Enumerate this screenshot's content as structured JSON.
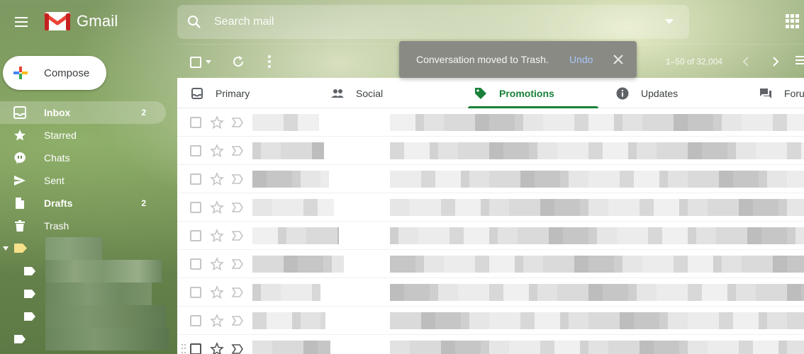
{
  "app": {
    "name": "Gmail",
    "brand_red": "#ea4335",
    "accent_green": "#188038"
  },
  "search": {
    "placeholder": "Search mail"
  },
  "compose": {
    "label": "Compose"
  },
  "sidebar": {
    "items": [
      {
        "label": "Inbox",
        "count": "2",
        "icon": "inbox-icon",
        "active": true,
        "bold": true
      },
      {
        "label": "Starred",
        "count": "",
        "icon": "star-icon",
        "active": false,
        "bold": false
      },
      {
        "label": "Chats",
        "count": "",
        "icon": "chat-icon",
        "active": false,
        "bold": false
      },
      {
        "label": "Sent",
        "count": "",
        "icon": "send-icon",
        "active": false,
        "bold": false
      },
      {
        "label": "Drafts",
        "count": "2",
        "icon": "draft-icon",
        "active": false,
        "bold": true
      },
      {
        "label": "Trash",
        "count": "",
        "icon": "trash-icon",
        "active": false,
        "bold": false
      }
    ],
    "label_icon_color": "#f6e08a"
  },
  "toolbar": {
    "page_info": "1–50 of 32,004"
  },
  "toast": {
    "message": "Conversation moved to Trash.",
    "undo": "Undo"
  },
  "tabs": [
    {
      "label": "Primary",
      "icon": "inbox-tab-icon",
      "active": false
    },
    {
      "label": "Social",
      "icon": "people-icon",
      "active": false
    },
    {
      "label": "Promotions",
      "icon": "tag-icon",
      "active": true
    },
    {
      "label": "Updates",
      "icon": "info-icon",
      "active": false
    },
    {
      "label": "Foru",
      "icon": "forum-icon",
      "active": false
    }
  ]
}
